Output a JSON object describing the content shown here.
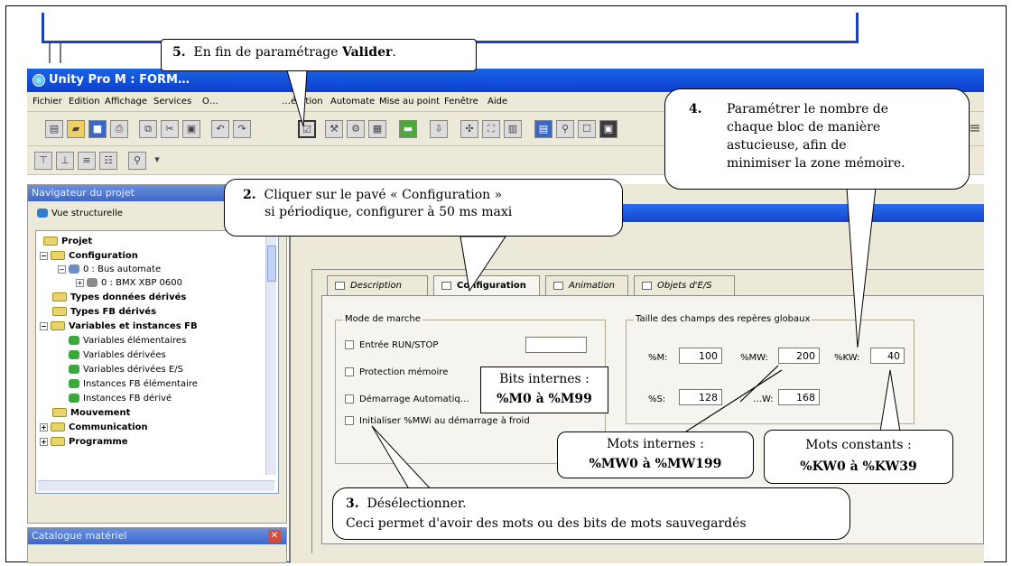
{
  "window": {
    "title": "Unity Pro M : FORM…",
    "menu": [
      "Fichier",
      "Edition",
      "Affichage",
      "Services",
      "O…",
      "…ération",
      "Automate",
      "Mise au point",
      "Fenêtre",
      "Aide"
    ]
  },
  "navigator": {
    "title": "Navigateur du projet",
    "view_label": "Vue structurelle",
    "tree": [
      {
        "label": "Projet",
        "bold": true
      },
      {
        "label": "Configuration",
        "bold": true
      },
      {
        "label": "0 : Bus automate",
        "bold": false
      },
      {
        "label": "0 : BMX XBP 0600",
        "bold": false
      },
      {
        "label": "Types données dérivés",
        "bold": true
      },
      {
        "label": "Types FB dérivés",
        "bold": true
      },
      {
        "label": "Variables et instances FB",
        "bold": true
      },
      {
        "label": "Variables élémentaires",
        "bold": false
      },
      {
        "label": "Variables dérivées",
        "bold": false
      },
      {
        "label": "Variables dérivées E/S",
        "bold": false
      },
      {
        "label": "Instances FB élémentaire",
        "bold": false
      },
      {
        "label": "Instances FB dérivé",
        "bold": false
      },
      {
        "label": "Mouvement",
        "bold": true
      },
      {
        "label": "Communication",
        "bold": true
      },
      {
        "label": "Programme",
        "bold": true
      }
    ]
  },
  "catalogue": {
    "title": "Catalogue matériel"
  },
  "tabs": [
    {
      "label": "Description"
    },
    {
      "label": "Configuration"
    },
    {
      "label": "Animation"
    },
    {
      "label": "Objets d'E/S"
    }
  ],
  "mode_group": {
    "label": "Mode de marche",
    "options": [
      "Entrée RUN/STOP",
      "Protection mémoire",
      "Démarrage Automatiq…",
      "Initialiser %MWi au démarrage à froid"
    ]
  },
  "globals_group": {
    "label": "Taille des champs des repères globaux",
    "fields": [
      {
        "label": "%M:",
        "value": "100"
      },
      {
        "label": "%MW:",
        "value": "200"
      },
      {
        "label": "%KW:",
        "value": "40"
      },
      {
        "label": "%S:",
        "value": "128"
      },
      {
        "label": "…W:",
        "value": "168"
      }
    ]
  },
  "annotations": {
    "step5": {
      "num": "5.",
      "text_a": "En fin de paramétrage ",
      "text_b": "Valider",
      "text_c": "."
    },
    "step2": {
      "num": "2.",
      "line1": "Cliquer sur le pavé « Configuration »",
      "line2": "si périodique, configurer à 50 ms maxi"
    },
    "step4": {
      "num": "4.",
      "lines": [
        "Paramétrer le nombre de",
        "chaque bloc de manière",
        "astucieuse, afin de",
        "minimiser la zone mémoire."
      ]
    },
    "step3": {
      "num": "3.",
      "line1": "Désélectionner.",
      "line2": "Ceci permet d'avoir des mots ou des bits de mots sauvegardés"
    },
    "bits": {
      "line1": "Bits internes :",
      "line2": "%M0 à %M99"
    },
    "mots": {
      "line1": "Mots internes :",
      "line2": "%MW0 à %MW199"
    },
    "constants": {
      "line1": "Mots constants :",
      "line2": "%KW0 à %KW39"
    }
  }
}
